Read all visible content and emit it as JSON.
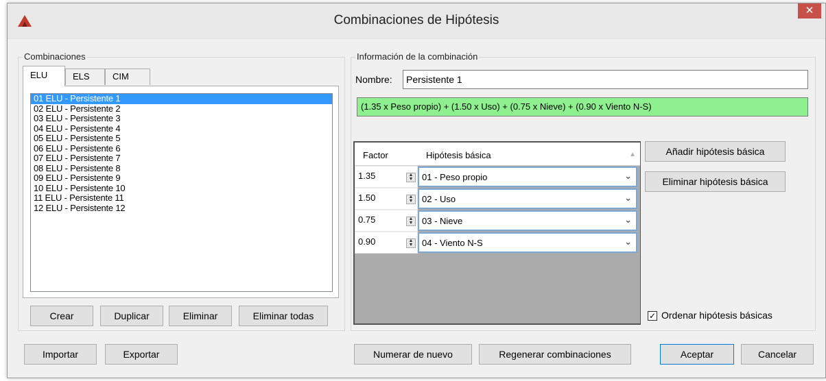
{
  "window": {
    "title": "Combinaciones de Hipótesis",
    "close_glyph": "✕"
  },
  "combinaciones": {
    "group_label": "Combinaciones",
    "tabs": [
      "ELU",
      "ELS",
      "CIM"
    ],
    "active_tab": "ELU",
    "items": [
      "01 ELU - Persistente 1",
      "02 ELU - Persistente 2",
      "03 ELU - Persistente 3",
      "04 ELU - Persistente 4",
      "05 ELU - Persistente 5",
      "06 ELU - Persistente 6",
      "07 ELU - Persistente 7",
      "08 ELU - Persistente 8",
      "09 ELU - Persistente 9",
      "10 ELU - Persistente 10",
      "11 ELU - Persistente 11",
      "12 ELU - Persistente 12"
    ],
    "selected_index": 0,
    "buttons": {
      "crear": "Crear",
      "duplicar": "Duplicar",
      "eliminar": "Eliminar",
      "eliminar_todas": "Eliminar todas"
    }
  },
  "info": {
    "group_label": "Información de la combinación",
    "nombre_label": "Nombre:",
    "nombre_value": "Persistente 1",
    "formula": "(1.35 x Peso propio) + (1.50 x Uso) + (0.75 x Nieve) + (0.90 x Viento N-S)",
    "formula_color": "#8ff08f",
    "grid": {
      "col_factor": "Factor",
      "col_hipotesis": "Hipótesis básica",
      "rows": [
        {
          "factor": "1.35",
          "hipotesis": "01 - Peso propio"
        },
        {
          "factor": "1.50",
          "hipotesis": "02 - Uso"
        },
        {
          "factor": "0.75",
          "hipotesis": "03 - Nieve"
        },
        {
          "factor": "0.90",
          "hipotesis": "04 - Viento N-S"
        }
      ]
    },
    "add_button": "Añadir hipótesis básica",
    "remove_button": "Eliminar hipótesis básica",
    "order_checkbox_label": "Ordenar hipótesis básicas",
    "order_checked": true
  },
  "footer": {
    "importar": "Importar",
    "exportar": "Exportar",
    "numerar": "Numerar de nuevo",
    "regenerar": "Regenerar combinaciones",
    "aceptar": "Aceptar",
    "cancelar": "Cancelar"
  },
  "icons": {
    "app": "app-logo-icon",
    "close": "close-icon",
    "spinner": "spinner-icon",
    "dropdown": "chevron-down-icon",
    "sort": "sort-up-icon",
    "check": "check-icon"
  }
}
